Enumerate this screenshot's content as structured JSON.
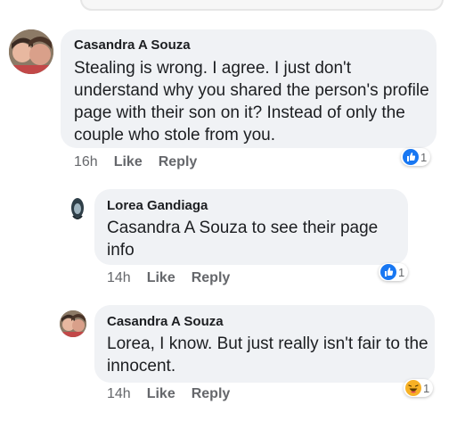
{
  "comments": [
    {
      "author": "Casandra A Souza",
      "text": "Stealing is wrong. I agree. I just don't understand why you shared the person's profile page with their son on it? Instead of only the couple who stole from you.",
      "time": "16h",
      "like_label": "Like",
      "reply_label": "Reply",
      "reaction": {
        "type": "like",
        "count": "1"
      }
    },
    {
      "author": "Lorea Gandiaga",
      "text": "Casandra A Souza to see their page info",
      "time": "14h",
      "like_label": "Like",
      "reply_label": "Reply",
      "reaction": {
        "type": "like",
        "count": "1"
      }
    },
    {
      "author": "Casandra A Souza",
      "text": "Lorea, I know. But just really isn't fair to the innocent.",
      "time": "14h",
      "like_label": "Like",
      "reply_label": "Reply",
      "reaction": {
        "type": "haha",
        "count": "1"
      }
    }
  ],
  "colors": {
    "bubble": "#f0f2f5",
    "meta_text": "#65676b",
    "like_blue": "#1877f2",
    "haha_yellow": "#f7b125"
  }
}
